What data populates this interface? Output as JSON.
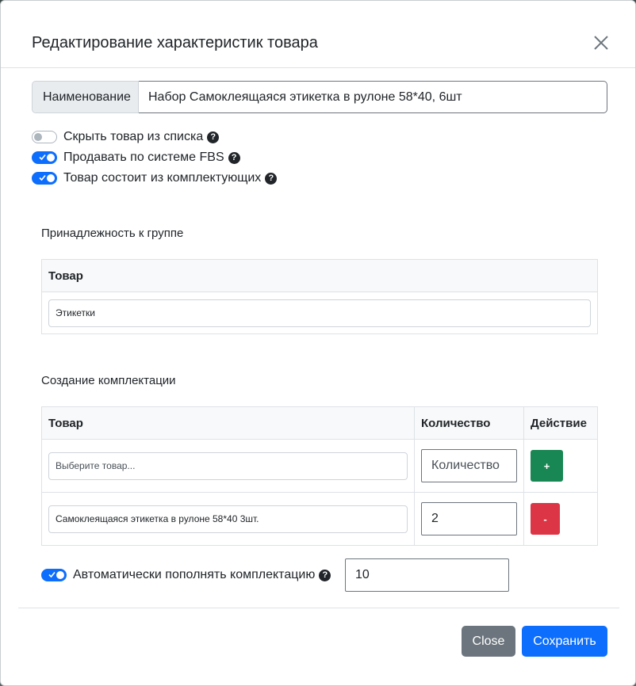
{
  "modal": {
    "title": "Редактирование характеристик товара"
  },
  "name_field": {
    "label": "Наименование",
    "value": "Набор Самоклеящаяся этикетка в рулоне 58*40, 6шт"
  },
  "switches": [
    {
      "label": "Скрыть товар из списка",
      "checked": false
    },
    {
      "label": "Продавать по системе FBS",
      "checked": true
    },
    {
      "label": "Товар состоит из комплектующих",
      "checked": true
    }
  ],
  "group_section": {
    "label": "Принадлежность к группе",
    "column_header": "Товар",
    "value": "Этикетки"
  },
  "kit_section": {
    "label": "Создание комплектации",
    "headers": [
      "Товар",
      "Количество",
      "Действие"
    ],
    "new_row": {
      "product_placeholder": "Выберите товар...",
      "qty_placeholder": "Количество",
      "action_label": "+"
    },
    "rows": [
      {
        "product": "Самоклеящаяся этикетка в рулоне 58*40 3шт.",
        "qty": "2",
        "action_label": "-"
      }
    ]
  },
  "auto_fill": {
    "label": "Автоматически пополнять комплектацию",
    "checked": true,
    "value": "10"
  },
  "footer": {
    "close_label": "Close",
    "save_label": "Сохранить"
  },
  "colors": {
    "primary": "#0d6efd",
    "secondary": "#6c757d",
    "success": "#198754",
    "danger": "#dc3545"
  }
}
